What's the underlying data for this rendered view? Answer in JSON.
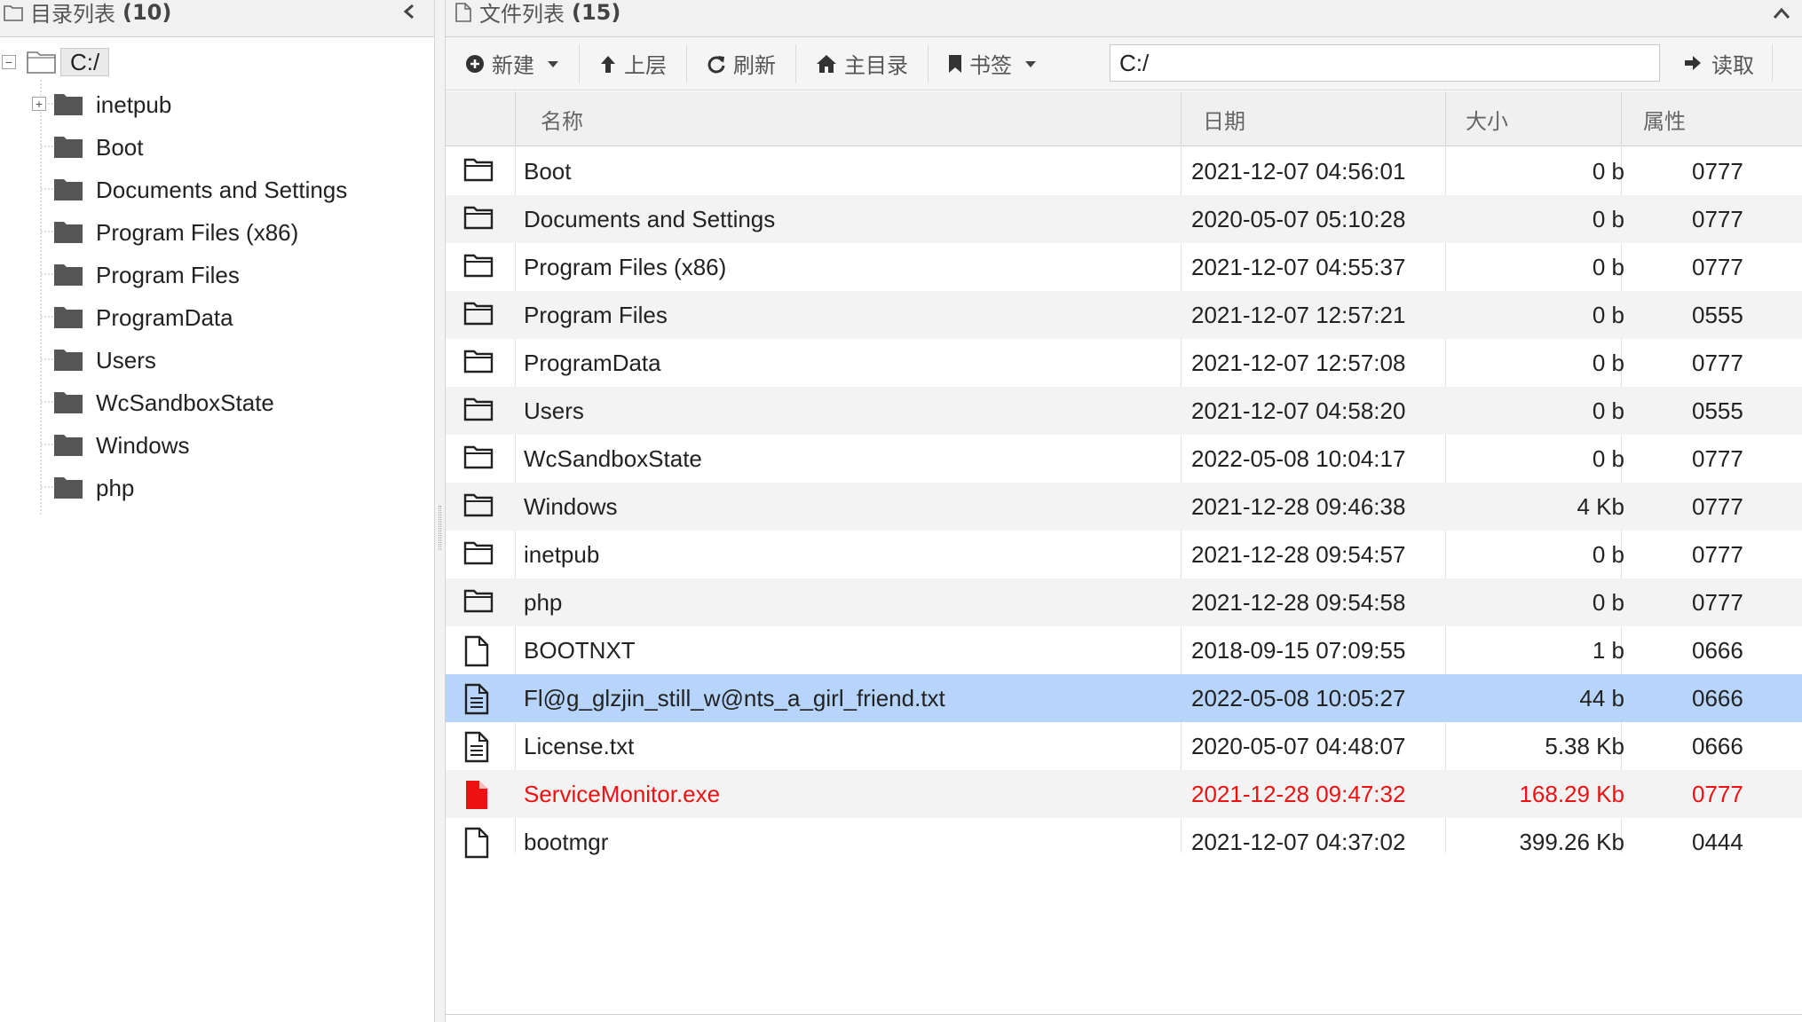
{
  "left_panel": {
    "title": "目录列表",
    "count": "(10)",
    "root_label": "C:/",
    "items": [
      {
        "label": "inetpub",
        "expandable": true
      },
      {
        "label": "Boot"
      },
      {
        "label": "Documents and Settings"
      },
      {
        "label": "Program Files (x86)"
      },
      {
        "label": "Program Files"
      },
      {
        "label": "ProgramData"
      },
      {
        "label": "Users"
      },
      {
        "label": "WcSandboxState"
      },
      {
        "label": "Windows"
      },
      {
        "label": "php"
      }
    ]
  },
  "right_panel": {
    "title": "文件列表",
    "count": "(15)",
    "toolbar": {
      "new_label": "新建",
      "up_label": "上层",
      "refresh_label": "刷新",
      "home_label": "主目录",
      "bookmark_label": "书签",
      "path_value": "C:/",
      "read_label": "读取"
    },
    "columns": {
      "name": "名称",
      "date": "日期",
      "size": "大小",
      "perm": "属性"
    },
    "files": [
      {
        "name": "Boot",
        "date": "2021-12-07 04:56:01",
        "size": "0 b",
        "perm": "0777",
        "type": "folder"
      },
      {
        "name": "Documents and Settings",
        "date": "2020-05-07 05:10:28",
        "size": "0 b",
        "perm": "0777",
        "type": "folder"
      },
      {
        "name": "Program Files (x86)",
        "date": "2021-12-07 04:55:37",
        "size": "0 b",
        "perm": "0777",
        "type": "folder"
      },
      {
        "name": "Program Files",
        "date": "2021-12-07 12:57:21",
        "size": "0 b",
        "perm": "0555",
        "type": "folder"
      },
      {
        "name": "ProgramData",
        "date": "2021-12-07 12:57:08",
        "size": "0 b",
        "perm": "0777",
        "type": "folder"
      },
      {
        "name": "Users",
        "date": "2021-12-07 04:58:20",
        "size": "0 b",
        "perm": "0555",
        "type": "folder"
      },
      {
        "name": "WcSandboxState",
        "date": "2022-05-08 10:04:17",
        "size": "0 b",
        "perm": "0777",
        "type": "folder"
      },
      {
        "name": "Windows",
        "date": "2021-12-28 09:46:38",
        "size": "4 Kb",
        "perm": "0777",
        "type": "folder"
      },
      {
        "name": "inetpub",
        "date": "2021-12-28 09:54:57",
        "size": "0 b",
        "perm": "0777",
        "type": "folder"
      },
      {
        "name": "php",
        "date": "2021-12-28 09:54:58",
        "size": "0 b",
        "perm": "0777",
        "type": "folder"
      },
      {
        "name": "BOOTNXT",
        "date": "2018-09-15 07:09:55",
        "size": "1 b",
        "perm": "0666",
        "type": "file"
      },
      {
        "name": "Fl@g_glzjin_still_w@nts_a_girl_friend.txt",
        "date": "2022-05-08 10:05:27",
        "size": "44 b",
        "perm": "0666",
        "type": "text",
        "selected": true
      },
      {
        "name": "License.txt",
        "date": "2020-05-07 04:48:07",
        "size": "5.38 Kb",
        "perm": "0666",
        "type": "text"
      },
      {
        "name": "ServiceMonitor.exe",
        "date": "2021-12-28 09:47:32",
        "size": "168.29 Kb",
        "perm": "0777",
        "type": "exe",
        "highlight_color": "#ee1111"
      },
      {
        "name": "bootmgr",
        "date": "2021-12-07 04:37:02",
        "size": "399.26 Kb",
        "perm": "0444",
        "type": "file"
      }
    ]
  },
  "colors": {
    "selected_row": "#b7d5fb",
    "alt_row": "#f3f3f3",
    "header_bg": "#f1f1f1",
    "danger": "#ee1111"
  }
}
